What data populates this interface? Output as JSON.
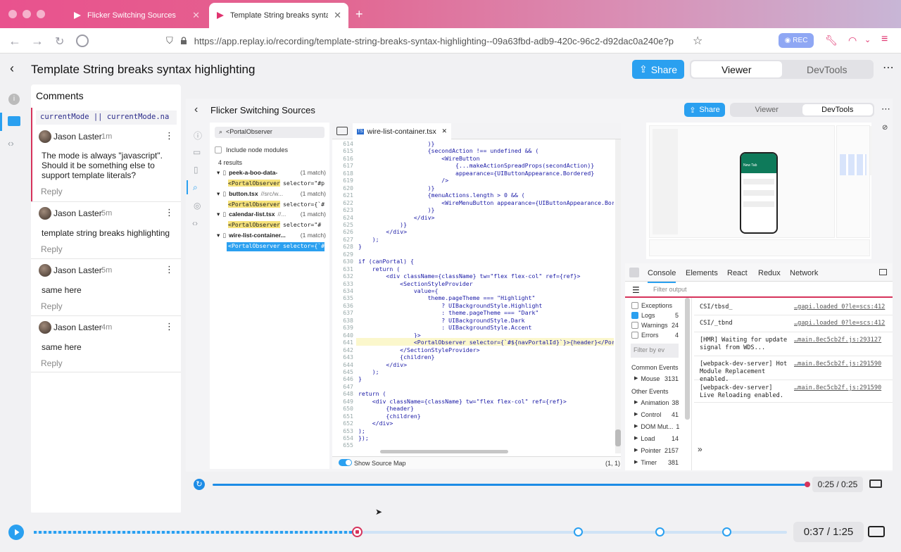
{
  "browser": {
    "tabs": [
      {
        "title": "Flicker Switching Sources",
        "active": false
      },
      {
        "title": "Template String breaks syntax hi",
        "active": true
      }
    ],
    "url": "https://app.replay.io/recording/template-string-breaks-syntax-highlighting--09a63fbd-adb9-420c-96c2-d92dac0a240e?p",
    "rec_label": "REC"
  },
  "header": {
    "title": "Template String breaks syntax highlighting",
    "share_label": "Share",
    "viewer_label": "Viewer",
    "devtools_label": "DevTools",
    "mode": "Viewer"
  },
  "comments": {
    "title": "Comments",
    "snippet": "currentMode || currentMode.na",
    "items": [
      {
        "author": "Jason Laster",
        "time": "1m",
        "text": "The mode is always \"javascript\". Should it be something else to support template literals?",
        "reply": "Reply"
      },
      {
        "author": "Jason Laster",
        "time": "5m",
        "text": "template string breaks highlighting",
        "reply": "Reply"
      },
      {
        "author": "Jason Laster",
        "time": "5m",
        "text": "same here",
        "reply": "Reply"
      },
      {
        "author": "Jason Laster",
        "time": "4m",
        "text": "same here",
        "reply": "Reply"
      }
    ]
  },
  "inner": {
    "title": "Flicker Switching Sources",
    "share_label": "Share",
    "viewer_label": "Viewer",
    "devtools_label": "DevTools",
    "search": {
      "query": "<PortalObserver",
      "include_node_modules": "Include node modules",
      "results_count": "4 results",
      "results": [
        {
          "file": "peek-a-boo-data-",
          "path": "",
          "matches": "(1 match)",
          "snippet": "selector=\"#p"
        },
        {
          "file": "button.tsx",
          "path": "//src/w...",
          "matches": "(1 match)",
          "snippet": "selector={`#"
        },
        {
          "file": "calendar-list.tsx",
          "path": "//...",
          "matches": "(1 match)",
          "snippet": "selector=\"#"
        },
        {
          "file": "wire-list-container...",
          "path": "",
          "matches": "(1 match)",
          "snippet": "selector={`#"
        }
      ],
      "match_word": "PortalObserver"
    },
    "editor": {
      "tab": "wire-list-container.tsx",
      "lines": [
        {
          "n": "614",
          "code": "                    )}"
        },
        {
          "n": "615",
          "code": "                    {secondAction !== undefined && ("
        },
        {
          "n": "616",
          "code": "                        <WireButton"
        },
        {
          "n": "617",
          "code": "                            {...makeActionSpreadProps(secondAction)}"
        },
        {
          "n": "618",
          "code": "                            appearance={UIButtonAppearance.Bordered}"
        },
        {
          "n": "619",
          "code": "                        />"
        },
        {
          "n": "620",
          "code": "                    )}"
        },
        {
          "n": "621",
          "code": "                    {menuActions.length > 0 && ("
        },
        {
          "n": "622",
          "code": "                        <WireMenuButton appearance={UIButtonAppearance.Bor"
        },
        {
          "n": "623",
          "code": "                    )}"
        },
        {
          "n": "624",
          "code": "                </div>"
        },
        {
          "n": "625",
          "code": "            )}"
        },
        {
          "n": "626",
          "code": "        </div>"
        },
        {
          "n": "627",
          "code": "    );"
        },
        {
          "n": "628",
          "code": "}"
        },
        {
          "n": "629",
          "code": ""
        },
        {
          "n": "630",
          "code": "if (canPortal) {"
        },
        {
          "n": "631",
          "code": "    return ("
        },
        {
          "n": "632",
          "code": "        <div className={className} tw=\"flex flex-col\" ref={ref}>"
        },
        {
          "n": "633",
          "code": "            <SectionStyleProvider"
        },
        {
          "n": "634",
          "code": "                value={"
        },
        {
          "n": "635",
          "code": "                    theme.pageTheme === \"Highlight\""
        },
        {
          "n": "636",
          "code": "                        ? UIBackgroundStyle.Highlight"
        },
        {
          "n": "637",
          "code": "                        : theme.pageTheme === \"Dark\""
        },
        {
          "n": "638",
          "code": "                        ? UIBackgroundStyle.Dark"
        },
        {
          "n": "639",
          "code": "                        : UIBackgroundStyle.Accent"
        },
        {
          "n": "640",
          "code": "                }>"
        },
        {
          "n": "641",
          "code": "                <PortalObserver selector={`#${navPortalId}`}>{header}</Por"
        },
        {
          "n": "642",
          "code": "            </SectionStyleProvider>"
        },
        {
          "n": "643",
          "code": "            {children}"
        },
        {
          "n": "644",
          "code": "        </div>"
        },
        {
          "n": "645",
          "code": "    );"
        },
        {
          "n": "646",
          "code": "}"
        },
        {
          "n": "647",
          "code": ""
        },
        {
          "n": "648",
          "code": "return ("
        },
        {
          "n": "649",
          "code": "    <div className={className} tw=\"flex flex-col\" ref={ref}>"
        },
        {
          "n": "650",
          "code": "        {header}"
        },
        {
          "n": "651",
          "code": "        {children}"
        },
        {
          "n": "652",
          "code": "    </div>"
        },
        {
          "n": "653",
          "code": ");"
        },
        {
          "n": "654",
          "code": "});"
        },
        {
          "n": "655",
          "code": ""
        }
      ],
      "highlight_line": "641",
      "source_map_label": "Show Source Map",
      "cursor_pos": "(1, 1)"
    },
    "preview": {
      "app_header": "New Tab"
    },
    "console": {
      "tabs": [
        "Console",
        "Elements",
        "React",
        "Redux",
        "Network"
      ],
      "active_tab": "Console",
      "filter_placeholder": "Filter output",
      "levels": [
        {
          "label": "Exceptions",
          "count": "",
          "checked": false
        },
        {
          "label": "Logs",
          "count": "5",
          "checked": true
        },
        {
          "label": "Warnings",
          "count": "24",
          "checked": false
        },
        {
          "label": "Errors",
          "count": "4",
          "checked": false
        }
      ],
      "event_filter_placeholder": "Filter by ev",
      "common_events_title": "Common Events",
      "common_events": [
        {
          "label": "Mouse",
          "count": "3131"
        }
      ],
      "other_events_title": "Other Events",
      "other_events": [
        {
          "label": "Animation",
          "count": "38"
        },
        {
          "label": "Control",
          "count": "41"
        },
        {
          "label": "DOM Mut...",
          "count": "1"
        },
        {
          "label": "Load",
          "count": "14"
        },
        {
          "label": "Pointer",
          "count": "2157"
        },
        {
          "label": "Timer",
          "count": "381"
        }
      ],
      "logs": [
        {
          "text": "CSI/tbsd_",
          "source": "…gapi.loaded_0?le=scs:412"
        },
        {
          "text": "CSI/_tbnd",
          "source": "…gapi.loaded_0?le=scs:412"
        },
        {
          "text": "[HMR] Waiting for update signal from WDS...",
          "source": "…main.8ec5cb2f.js:293127"
        },
        {
          "text": "[webpack-dev-server] Hot Module Replacement enabled.",
          "source": "…main.8ec5cb2f.js:291590"
        },
        {
          "text": "[webpack-dev-server] Live Reloading enabled.",
          "source": "…main.8ec5cb2f.js:291590"
        }
      ],
      "prompt": "»"
    },
    "timeline": {
      "time": "0:25 / 0:25",
      "progress": 1.0
    }
  },
  "timeline": {
    "current": "0:37",
    "total": "1:25",
    "separator": "/",
    "progress": 0.435
  },
  "colors": {
    "accent": "#2aa0f0",
    "timeline": "#1d8ce6",
    "comment_marker": "#d6335b",
    "highlight_line": "#fbf7cc",
    "match_highlight": "#f6e27a"
  }
}
